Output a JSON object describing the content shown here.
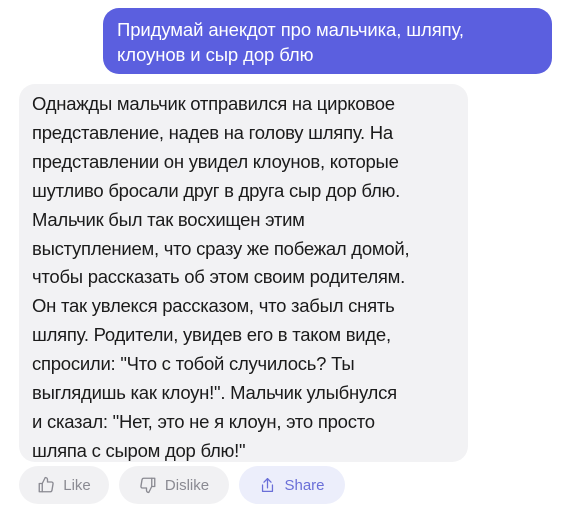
{
  "user_message": {
    "lines": [
      "Придумай анекдот про мальчика, шляпу,",
      "клоунов и сыр дор блю"
    ]
  },
  "bot_message": {
    "lines": [
      "Однажды мальчик отправился на цирковое",
      "представление, надев на голову шляпу. На",
      "представлении он увидел клоунов, которые",
      "шутливо бросали друг в друга сыр дор блю.",
      "Мальчик был так восхищен этим",
      "выступлением, что сразу же побежал домой,",
      "чтобы рассказать об этом своим родителям.",
      "Он так увлекся рассказом, что забыл снять",
      "шляпу. Родители, увидев его в таком виде,",
      "спросили: \"Что с тобой случилось? Ты",
      "выглядишь как клоун!\". Мальчик улыбнулся",
      "и сказал: \"Нет, это не я клоун, это просто",
      "шляпа с сыром дор блю!\""
    ]
  },
  "actions": {
    "like_label": "Like",
    "dislike_label": "Dislike",
    "share_label": "Share",
    "like_icon": "thumbs-up-icon",
    "dislike_icon": "thumbs-down-icon",
    "share_icon": "share-icon"
  },
  "colors": {
    "user_bubble": "#5b5fdf",
    "bot_bubble": "#f2f2f4",
    "share_accent": "#6a6fd8"
  }
}
